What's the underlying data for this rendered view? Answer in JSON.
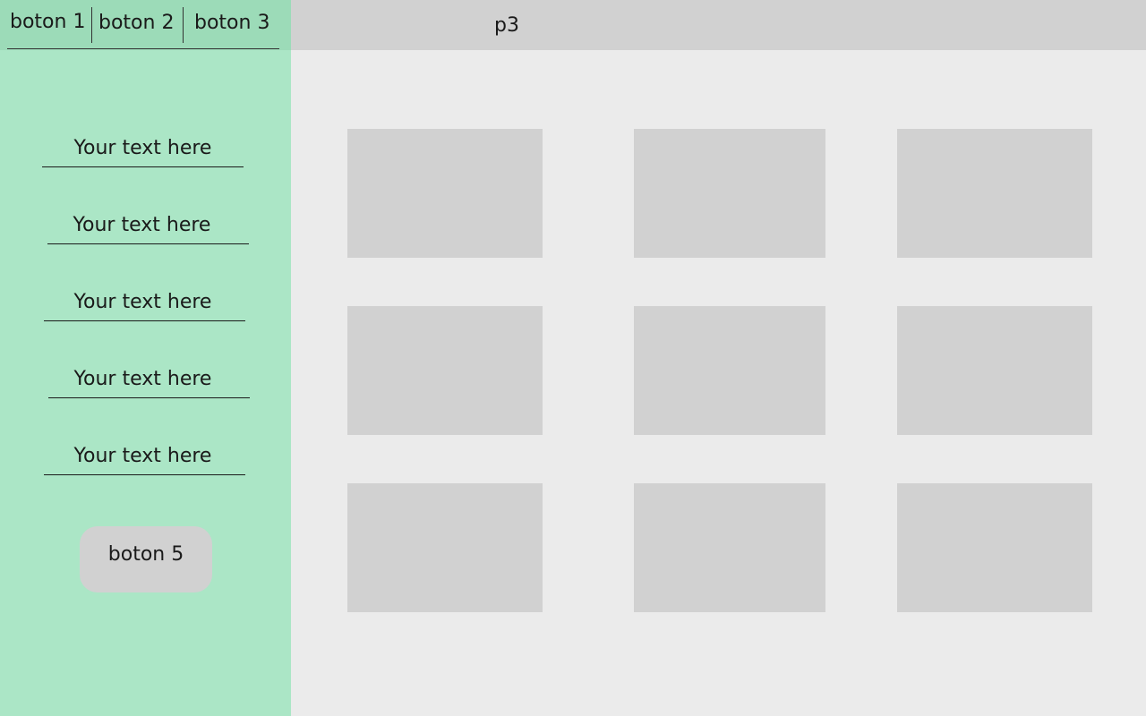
{
  "sidebar": {
    "tabs": [
      {
        "label": "boton 1"
      },
      {
        "label": "boton 2"
      },
      {
        "label": "boton 3"
      }
    ],
    "items": [
      {
        "label": "Your text here"
      },
      {
        "label": "Your text here"
      },
      {
        "label": "Your text here"
      },
      {
        "label": "Your text here"
      },
      {
        "label": "Your text here"
      }
    ],
    "button_label": "boton 5"
  },
  "topbar": {
    "title": "p3"
  },
  "grid": {
    "rows": 3,
    "columns": 3
  },
  "colors": {
    "sidebar": "#abe6c6",
    "sidebar_header": "#9cdbb8",
    "main": "#ebebeb",
    "placeholder": "#d1d1d1"
  }
}
